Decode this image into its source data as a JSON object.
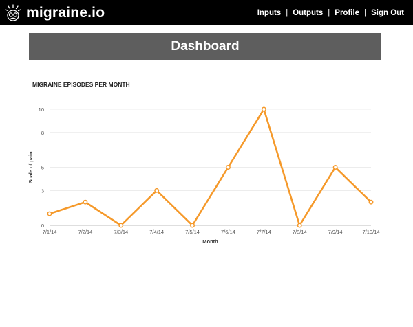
{
  "brand": {
    "name": "migraine.io",
    "logo_icon": "migraine-face-icon"
  },
  "nav": {
    "items": [
      "Inputs",
      "Outputs",
      "Profile",
      "Sign Out"
    ]
  },
  "page": {
    "title": "Dashboard"
  },
  "chart_data": {
    "type": "line",
    "title": "MIGRAINE EPISODES PER MONTH",
    "xlabel": "Month",
    "ylabel": "Scale of pain",
    "categories": [
      "7/1/14",
      "7/2/14",
      "7/3/14",
      "7/4/14",
      "7/5/14",
      "7/6/14",
      "7/7/14",
      "7/8/14",
      "7/9/14",
      "7/10/14"
    ],
    "values": [
      1,
      2,
      0,
      3,
      0,
      5,
      10,
      0,
      5,
      2
    ],
    "yticks": [
      "0",
      "3",
      "5",
      "8",
      "10"
    ],
    "ylim": [
      0,
      10
    ],
    "grid": true,
    "color": "#f5992a"
  }
}
